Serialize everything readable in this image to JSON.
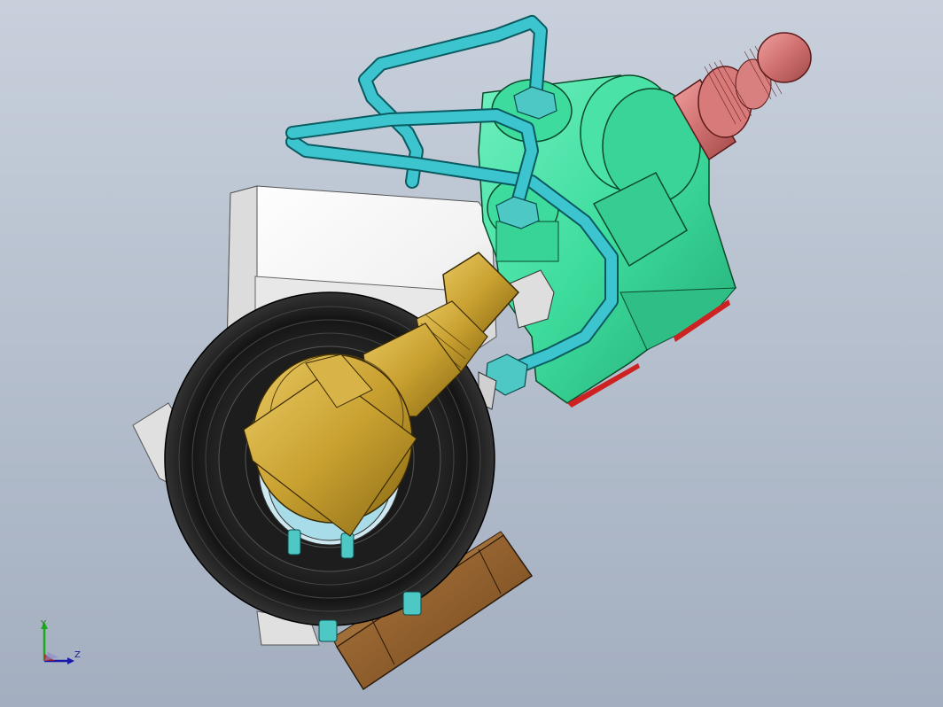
{
  "viewport": {
    "background_top": "#c8d0dc",
    "background_bottom": "#a3aec0"
  },
  "model": {
    "colors": {
      "tube": "#3cc4cf",
      "valve_body": "#3ddc9c",
      "connector": "#d07070",
      "brass": "#c8a030",
      "tire": "#1a1a1a",
      "housing": "#f2f2f2",
      "base_plate": "#8a5a2a",
      "nut": "#4ec8c4"
    }
  },
  "triad": {
    "axis_y": "Y",
    "axis_z": "Z",
    "axis_x": "",
    "colors": {
      "y": "#1aaa1a",
      "z": "#1a1aaa",
      "x": "#aa1a1a"
    }
  }
}
